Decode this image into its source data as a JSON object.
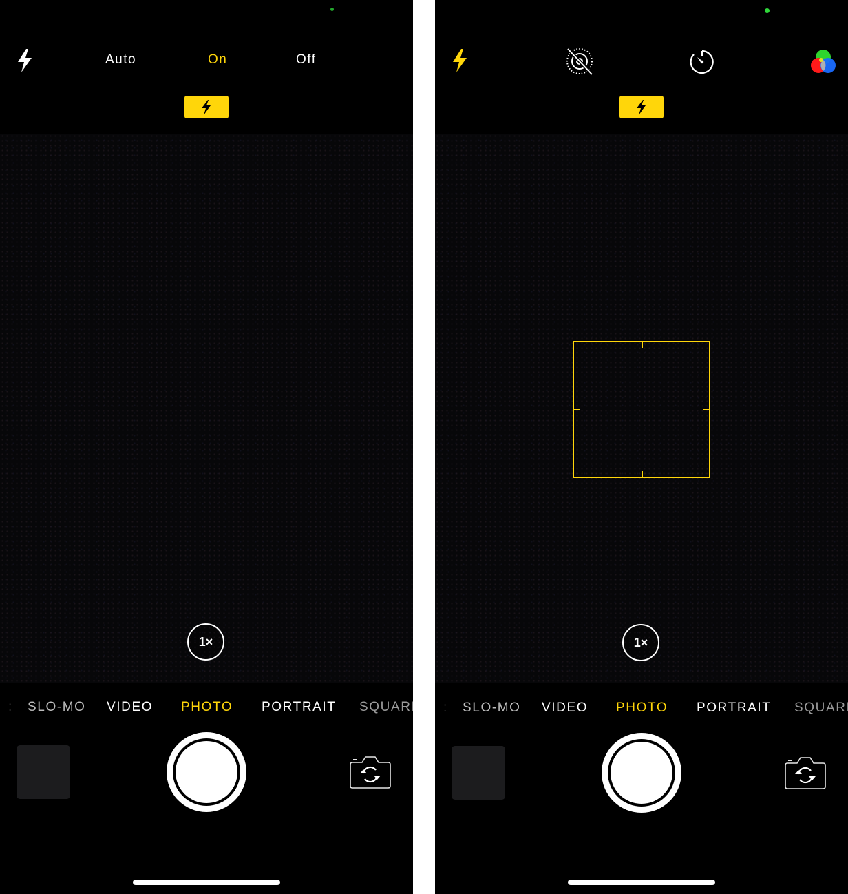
{
  "colors": {
    "accent_yellow": "#ffd60a",
    "background": "#000000",
    "text": "#ffffff",
    "divider": "#ffffff",
    "status_indicator": "#2fd63a"
  },
  "screens": [
    {
      "id": "left",
      "top_bar": {
        "flash_icon": "flash-bolt-icon",
        "flash_options": [
          {
            "label": "Auto",
            "selected": false
          },
          {
            "label": "On",
            "selected": true
          },
          {
            "label": "Off",
            "selected": false
          }
        ]
      },
      "flash_indicator": {
        "icon": "flash-bolt-icon",
        "state": "on"
      },
      "zoom_label": "1×",
      "modes": [
        {
          "label": "SLO-MO",
          "selected": false
        },
        {
          "label": "VIDEO",
          "selected": false
        },
        {
          "label": "PHOTO",
          "selected": true
        },
        {
          "label": "PORTRAIT",
          "selected": false
        },
        {
          "label": "SQUARE",
          "selected": false
        }
      ],
      "controls": {
        "thumbnail": "last-photo-thumbnail",
        "shutter": "shutter-button",
        "switch_camera_icon": "switch-camera-icon"
      }
    },
    {
      "id": "right",
      "top_bar": {
        "icons": [
          {
            "name": "flash-bolt-icon",
            "state": "on"
          },
          {
            "name": "live-photo-off-icon",
            "state": "off"
          },
          {
            "name": "timer-icon",
            "state": "off"
          },
          {
            "name": "filters-icon",
            "state": "off"
          }
        ]
      },
      "flash_indicator": {
        "icon": "flash-bolt-icon",
        "state": "on"
      },
      "focus_box": {
        "visible": true
      },
      "zoom_label": "1×",
      "modes": [
        {
          "label": "SLO-MO",
          "selected": false
        },
        {
          "label": "VIDEO",
          "selected": false
        },
        {
          "label": "PHOTO",
          "selected": true
        },
        {
          "label": "PORTRAIT",
          "selected": false
        },
        {
          "label": "SQUARE",
          "selected": false
        }
      ],
      "controls": {
        "thumbnail": "last-photo-thumbnail",
        "shutter": "shutter-button",
        "switch_camera_icon": "switch-camera-icon"
      }
    }
  ]
}
